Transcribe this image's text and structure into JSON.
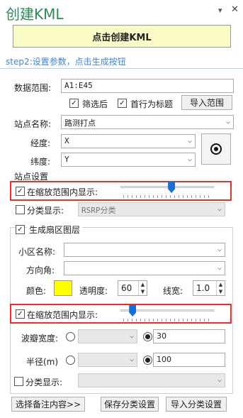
{
  "window": {
    "title": "创建KML",
    "pin_glyph": "▾",
    "close_glyph": "✕"
  },
  "create_button": "点击创建KML",
  "step_text": "step2:设置参数，点击生成按钮",
  "data_range": {
    "label": "数据范围:",
    "value": "A1:E45"
  },
  "filter_after": {
    "label": "筛选后",
    "checked": true
  },
  "first_row_header": {
    "label": "首行为标题",
    "checked": true
  },
  "import_range_button": "导入范围",
  "site_name": {
    "label": "站点名称:",
    "value": "路测打点"
  },
  "longitude": {
    "label": "经度:",
    "value": "X"
  },
  "latitude": {
    "label": "纬度:",
    "value": "Y"
  },
  "site_settings": {
    "title": "站点设置",
    "show_in_zoom": {
      "label": "在缩放范围内显示:",
      "checked": true,
      "slider_level": 0.55
    },
    "category_display": {
      "label": "分类显示:",
      "checked": false,
      "value": "RSRP分类"
    }
  },
  "sector_layer": {
    "label": "生成扇区图层",
    "checked": true,
    "cell_name": {
      "label": "小区名称:",
      "value": ""
    },
    "azimuth": {
      "label": "方向角:",
      "value": ""
    },
    "color": {
      "label": "颜色:",
      "value": "#ffff00"
    },
    "transparency": {
      "label": "透明度:",
      "value": "60"
    },
    "line_width": {
      "label": "线宽:",
      "value": "1.0"
    },
    "show_in_zoom": {
      "label": "在缩放范围内显示:",
      "checked": true,
      "slider_level": 0.1
    },
    "beam_width": {
      "label": "波瓣宽度:",
      "value": "30"
    },
    "radius": {
      "label": "半径(m)",
      "value": "100"
    },
    "category_display": {
      "label": "分类显示:",
      "checked": false,
      "value": ""
    }
  },
  "footer": {
    "select_note_button": "选择备注内容>>",
    "save_category_button": "保存分类设置",
    "import_category_button": "导入分类设置"
  }
}
